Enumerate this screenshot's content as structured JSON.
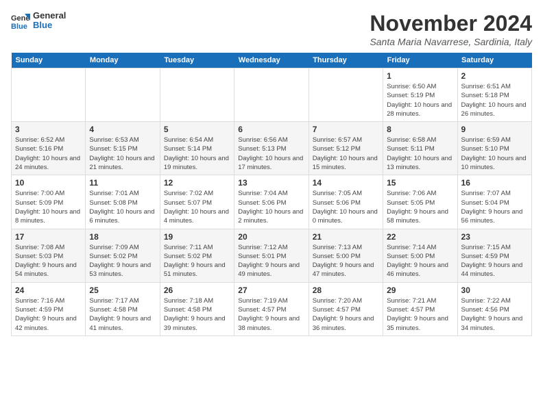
{
  "logo": {
    "text_general": "General",
    "text_blue": "Blue"
  },
  "header": {
    "month": "November 2024",
    "location": "Santa Maria Navarrese, Sardinia, Italy"
  },
  "weekdays": [
    "Sunday",
    "Monday",
    "Tuesday",
    "Wednesday",
    "Thursday",
    "Friday",
    "Saturday"
  ],
  "weeks": [
    [
      {
        "day": "",
        "info": ""
      },
      {
        "day": "",
        "info": ""
      },
      {
        "day": "",
        "info": ""
      },
      {
        "day": "",
        "info": ""
      },
      {
        "day": "",
        "info": ""
      },
      {
        "day": "1",
        "info": "Sunrise: 6:50 AM\nSunset: 5:19 PM\nDaylight: 10 hours and 28 minutes."
      },
      {
        "day": "2",
        "info": "Sunrise: 6:51 AM\nSunset: 5:18 PM\nDaylight: 10 hours and 26 minutes."
      }
    ],
    [
      {
        "day": "3",
        "info": "Sunrise: 6:52 AM\nSunset: 5:16 PM\nDaylight: 10 hours and 24 minutes."
      },
      {
        "day": "4",
        "info": "Sunrise: 6:53 AM\nSunset: 5:15 PM\nDaylight: 10 hours and 21 minutes."
      },
      {
        "day": "5",
        "info": "Sunrise: 6:54 AM\nSunset: 5:14 PM\nDaylight: 10 hours and 19 minutes."
      },
      {
        "day": "6",
        "info": "Sunrise: 6:56 AM\nSunset: 5:13 PM\nDaylight: 10 hours and 17 minutes."
      },
      {
        "day": "7",
        "info": "Sunrise: 6:57 AM\nSunset: 5:12 PM\nDaylight: 10 hours and 15 minutes."
      },
      {
        "day": "8",
        "info": "Sunrise: 6:58 AM\nSunset: 5:11 PM\nDaylight: 10 hours and 13 minutes."
      },
      {
        "day": "9",
        "info": "Sunrise: 6:59 AM\nSunset: 5:10 PM\nDaylight: 10 hours and 10 minutes."
      }
    ],
    [
      {
        "day": "10",
        "info": "Sunrise: 7:00 AM\nSunset: 5:09 PM\nDaylight: 10 hours and 8 minutes."
      },
      {
        "day": "11",
        "info": "Sunrise: 7:01 AM\nSunset: 5:08 PM\nDaylight: 10 hours and 6 minutes."
      },
      {
        "day": "12",
        "info": "Sunrise: 7:02 AM\nSunset: 5:07 PM\nDaylight: 10 hours and 4 minutes."
      },
      {
        "day": "13",
        "info": "Sunrise: 7:04 AM\nSunset: 5:06 PM\nDaylight: 10 hours and 2 minutes."
      },
      {
        "day": "14",
        "info": "Sunrise: 7:05 AM\nSunset: 5:06 PM\nDaylight: 10 hours and 0 minutes."
      },
      {
        "day": "15",
        "info": "Sunrise: 7:06 AM\nSunset: 5:05 PM\nDaylight: 9 hours and 58 minutes."
      },
      {
        "day": "16",
        "info": "Sunrise: 7:07 AM\nSunset: 5:04 PM\nDaylight: 9 hours and 56 minutes."
      }
    ],
    [
      {
        "day": "17",
        "info": "Sunrise: 7:08 AM\nSunset: 5:03 PM\nDaylight: 9 hours and 54 minutes."
      },
      {
        "day": "18",
        "info": "Sunrise: 7:09 AM\nSunset: 5:02 PM\nDaylight: 9 hours and 53 minutes."
      },
      {
        "day": "19",
        "info": "Sunrise: 7:11 AM\nSunset: 5:02 PM\nDaylight: 9 hours and 51 minutes."
      },
      {
        "day": "20",
        "info": "Sunrise: 7:12 AM\nSunset: 5:01 PM\nDaylight: 9 hours and 49 minutes."
      },
      {
        "day": "21",
        "info": "Sunrise: 7:13 AM\nSunset: 5:00 PM\nDaylight: 9 hours and 47 minutes."
      },
      {
        "day": "22",
        "info": "Sunrise: 7:14 AM\nSunset: 5:00 PM\nDaylight: 9 hours and 46 minutes."
      },
      {
        "day": "23",
        "info": "Sunrise: 7:15 AM\nSunset: 4:59 PM\nDaylight: 9 hours and 44 minutes."
      }
    ],
    [
      {
        "day": "24",
        "info": "Sunrise: 7:16 AM\nSunset: 4:59 PM\nDaylight: 9 hours and 42 minutes."
      },
      {
        "day": "25",
        "info": "Sunrise: 7:17 AM\nSunset: 4:58 PM\nDaylight: 9 hours and 41 minutes."
      },
      {
        "day": "26",
        "info": "Sunrise: 7:18 AM\nSunset: 4:58 PM\nDaylight: 9 hours and 39 minutes."
      },
      {
        "day": "27",
        "info": "Sunrise: 7:19 AM\nSunset: 4:57 PM\nDaylight: 9 hours and 38 minutes."
      },
      {
        "day": "28",
        "info": "Sunrise: 7:20 AM\nSunset: 4:57 PM\nDaylight: 9 hours and 36 minutes."
      },
      {
        "day": "29",
        "info": "Sunrise: 7:21 AM\nSunset: 4:57 PM\nDaylight: 9 hours and 35 minutes."
      },
      {
        "day": "30",
        "info": "Sunrise: 7:22 AM\nSunset: 4:56 PM\nDaylight: 9 hours and 34 minutes."
      }
    ]
  ]
}
